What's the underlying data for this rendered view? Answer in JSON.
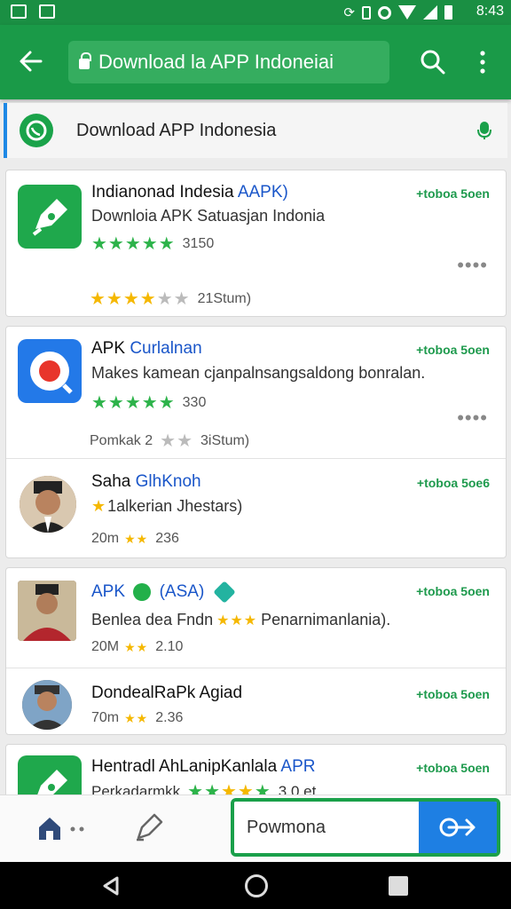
{
  "status_bar": {
    "time": "8:43"
  },
  "app_bar": {
    "url": "Download la APP Indoneiai"
  },
  "search": {
    "query": "Download APP Indonesia"
  },
  "list": [
    {
      "title": "Indianonad Indesia ",
      "title_highlight": "AAPK)",
      "subtitle": "Downloia APK Satuasjan Indonia",
      "rating_text": "3150",
      "meta_text": "21Stum)",
      "tag": "+toboa 5oen",
      "more": "••••"
    },
    {
      "title": "APK ",
      "title_highlight": "Curlalnan",
      "subtitle": "Makes kamean cjanpalnsangsaldong bonralan.",
      "rating_text": "330",
      "meta_text": "Pomkak 2",
      "meta_text2": "3iStum)",
      "tag": "+toboa 5oen",
      "more": "••••"
    },
    {
      "title": "Saha ",
      "title_highlight": "GlhKnoh",
      "subtitle": "1alkerian Jhestars)",
      "meta_text": "20m",
      "meta_value": "236",
      "tag": "+toboa 5oe6"
    },
    {
      "title_highlight": "APK",
      "title_highlight2": "(ASA)",
      "subtitle_pre": "Benlea dea Fndn",
      "subtitle_post": "Penarnimanlania).",
      "meta_text": "20M",
      "meta_value": "2.10",
      "tag": "+toboa 5oen"
    },
    {
      "title": "DondealRaPk Agiad",
      "meta_text": "70m",
      "meta_value": "2.36",
      "tag": "+toboa 5oen"
    },
    {
      "title": "Hentradl AhLanipKanlala ",
      "title_highlight": "APR",
      "subtitle": "Perkadarmkk",
      "meta_text": "3.0 et",
      "tag": "+toboa 5oen"
    }
  ],
  "bottom": {
    "input_value": "Powmona"
  },
  "colors": {
    "primary": "#1a9a48",
    "accent": "#1e7fe3",
    "star_green": "#2db34a",
    "star_yellow": "#f5b800"
  }
}
